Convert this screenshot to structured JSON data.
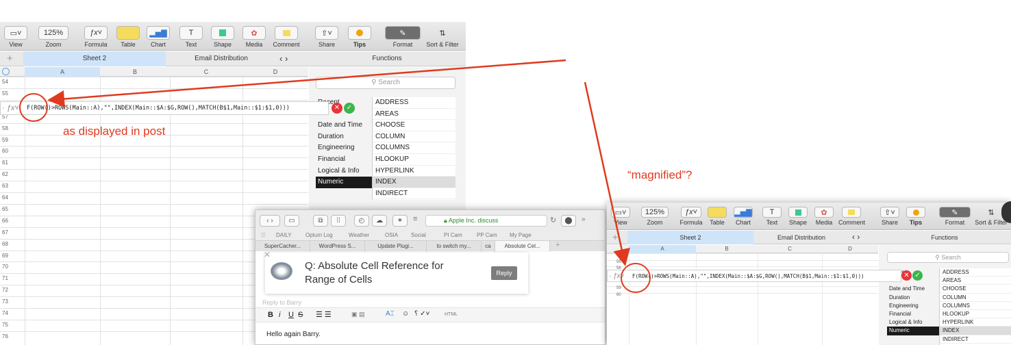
{
  "toolbar": {
    "items": [
      {
        "label": "View",
        "icon": "view-icon"
      },
      {
        "label": "Zoom",
        "value": "125%"
      },
      {
        "label": "Formula",
        "icon": "fx-icon"
      },
      {
        "label": "Table",
        "icon": "table-icon"
      },
      {
        "label": "Chart",
        "icon": "chart-icon"
      },
      {
        "label": "Text",
        "icon": "text-icon"
      },
      {
        "label": "Shape",
        "icon": "shape-icon"
      },
      {
        "label": "Media",
        "icon": "media-icon"
      },
      {
        "label": "Comment",
        "icon": "comment-icon"
      },
      {
        "label": "Share",
        "icon": "share-icon"
      },
      {
        "label": "Tips",
        "icon": "tips-icon"
      },
      {
        "label": "Format",
        "icon": "format-icon"
      },
      {
        "label": "Sort & Filter",
        "icon": "sort-icon"
      }
    ],
    "zoom_value": "125%",
    "fx_symbol": "fx"
  },
  "sheets": {
    "add": "+",
    "active": "Sheet 2",
    "other": "Email Distribution",
    "functions_title": "Functions"
  },
  "columns": [
    "A",
    "B",
    "C",
    "D"
  ],
  "rows_left": [
    "54",
    "55",
    "56",
    "57",
    "58",
    "59",
    "60",
    "61",
    "62",
    "63",
    "64",
    "65",
    "66",
    "67",
    "68",
    "69",
    "70",
    "71",
    "72",
    "73",
    "74",
    "75",
    "76"
  ],
  "rows_right": [
    "54",
    "55",
    "56",
    "57",
    "58",
    "59",
    "60"
  ],
  "formula_text": "F(ROW()>ROWS(Main::A),\"\",INDEX(Main::$A:$G,ROW(),MATCH(B$1,Main::$1:$1,0)))",
  "search_placeholder": "Search",
  "categories": [
    "Recent",
    "Date and Time",
    "Duration",
    "Engineering",
    "Financial",
    "Logical & Info",
    "Numeric"
  ],
  "functions": [
    "ADDRESS",
    "AREAS",
    "CHOOSE",
    "COLUMN",
    "COLUMNS",
    "HLOOKUP",
    "HYPERLINK",
    "INDEX",
    "INDIRECT"
  ],
  "annotations": {
    "left": "as displayed in post",
    "right": "“magnified”?"
  },
  "browser": {
    "address": "Apple Inc. discuss",
    "bookmarks": [
      "DAILY",
      "Optum Log",
      "Weather",
      "OSIA",
      "Social",
      "PI Cam",
      "PP Cam",
      "My Page"
    ],
    "tabs": [
      "SuperCacher...",
      "WordPress S...",
      "Update Plugi...",
      "to switch my...",
      "ca",
      "Absolute Cel..."
    ],
    "question": "Q: Absolute Cell Reference for Range of Cells",
    "reply_button": "Reply",
    "reply_to": "Reply to Barry",
    "editor_tools": [
      "B",
      "i",
      "U",
      "S"
    ],
    "html_label": "HTML",
    "body_text": "Hello again Barry."
  },
  "colors": {
    "annotation_red": "#e03a1e",
    "selected_row": "#dcdcdc",
    "category_selected": "#1a1a1a"
  }
}
